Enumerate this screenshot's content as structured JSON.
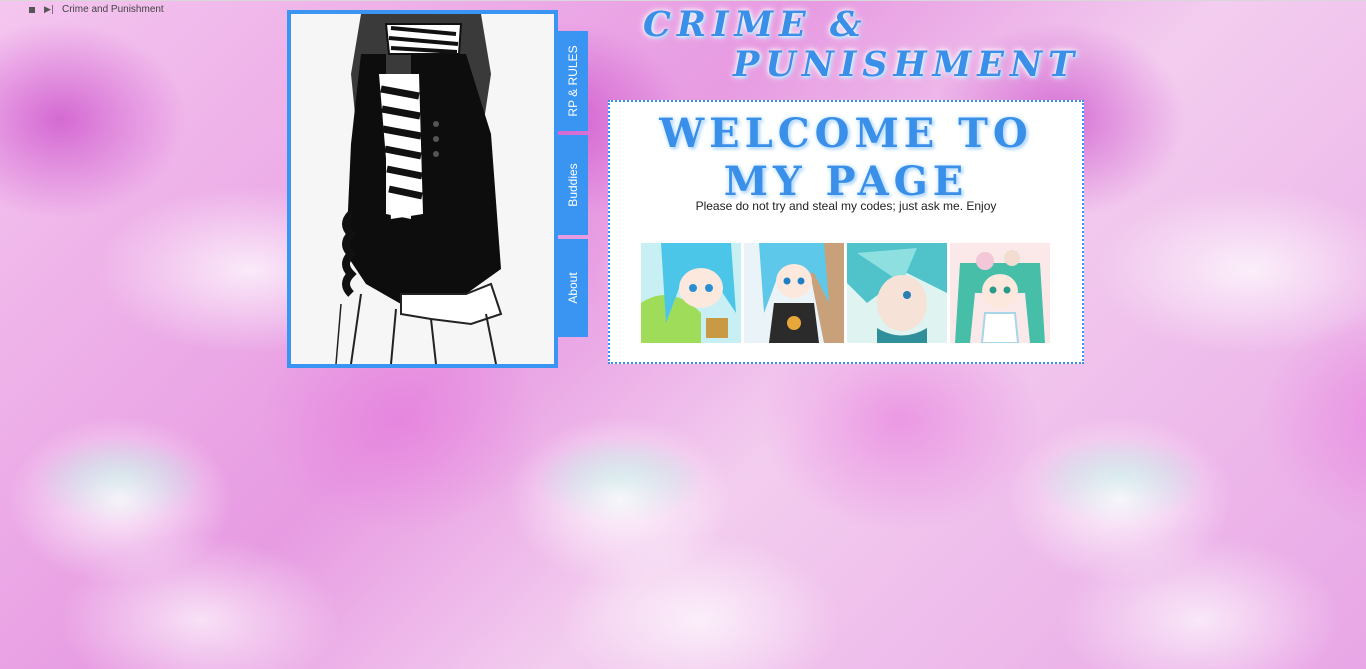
{
  "tab_bar": {
    "page_title": "Crime and Punishment"
  },
  "header": {
    "line1": "CRIME &",
    "line2": "PUNISHMENT"
  },
  "nav": {
    "tabs": [
      {
        "label": "RP & RULES"
      },
      {
        "label": "Buddies"
      },
      {
        "label": "About"
      }
    ]
  },
  "welcome": {
    "heading": "WELCOME TO MY PAGE",
    "note": "Please do not try and steal my codes; just ask me. Enjoy"
  },
  "colors": {
    "accent": "#3a95f2",
    "background_pink": "#e79be2"
  }
}
